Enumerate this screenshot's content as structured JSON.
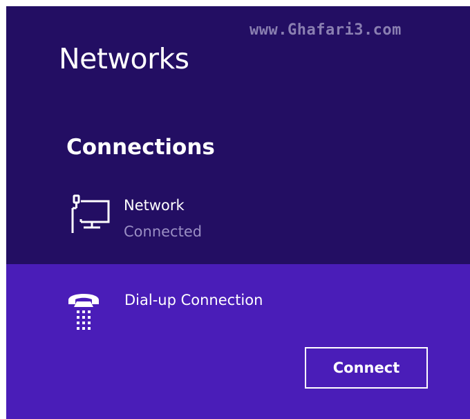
{
  "watermark": "www.Ghafari3.com",
  "title": "Networks",
  "connections": {
    "heading": "Connections",
    "items": [
      {
        "name": "Network",
        "status": "Connected",
        "icon": "wired-network-icon"
      }
    ]
  },
  "dialup": {
    "name": "Dial-up Connection",
    "icon": "telephone-icon",
    "connect_label": "Connect"
  },
  "colors": {
    "panel_background": "#230e63",
    "selected_background": "#4a1db8",
    "secondary_text": "#9a8fc4",
    "text": "#ffffff"
  }
}
